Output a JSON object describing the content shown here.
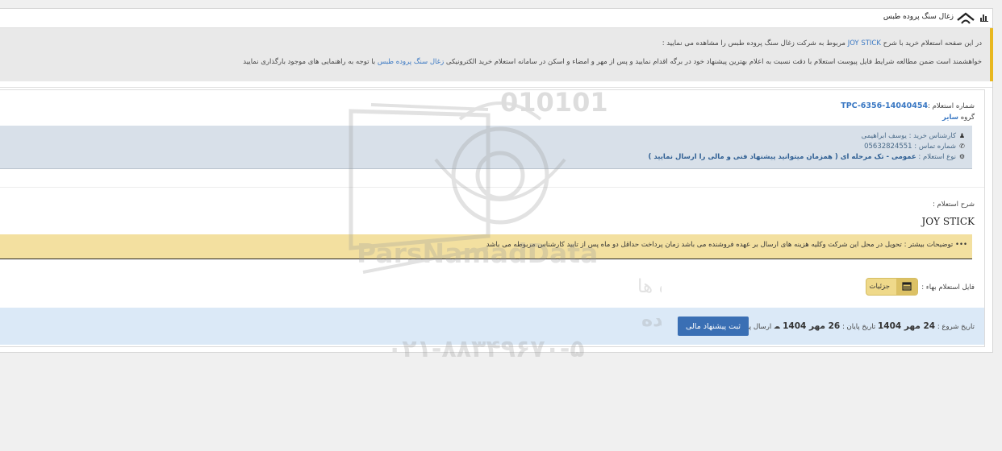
{
  "header": {
    "title": "زغال سنگ پروده طبس"
  },
  "intro": {
    "line1_pre": "در این صفحه استعلام خرید با شرح ",
    "line1_link": "JOY STICK",
    "line1_post": " مربوط به شرکت زغال سنگ پروده طبس را مشاهده می نمایید :",
    "line2_pre": "خواهشمند است ضمن مطالعه شرایط فایل پیوست استعلام با دقت نسبت به اعلام بهترین پیشنهاد خود در برگه اقدام نمایید و پس از مهر و امضاء و اسکن در سامانه استعلام خرید الکترونیکی ",
    "line2_link": "زغال سنگ پروده طبس",
    "line2_post": " با توجه به راهنمایی های موجود بارگذاری نمایید"
  },
  "inquiry": {
    "number_label": "شماره استعلام :",
    "number_value": "TPC-6356-14040454",
    "group_label": "گروه",
    "group_value": "سایر"
  },
  "contact": {
    "expert": "کارشناس خرید : یوسف ابراهیمی",
    "phone_label": "شماره تماس :",
    "phone_value": "05632824551",
    "type_label": "نوع استعلام :",
    "type_value": "عمومی - تک مرحله ای ( همزمان میتوانید پیشنهاد فنی و مالی را ارسال نمایید )"
  },
  "description": {
    "label": "شرح استعلام :",
    "value": "JOY STICK"
  },
  "note": {
    "text": "توضیحات بیشتر : تحویل در محل این شرکت وکلیه هزینه های ارسال بر عهده فروشنده می باشد زمان پرداخت حداقل دو ماه پس از تایید کارشناس مربوطه می باشد"
  },
  "file": {
    "label": "فایل استعلام بهاء :",
    "details_label": "جزئیات"
  },
  "dates": {
    "start_label": "تاریخ شروع :",
    "start_value": "24 مهر 1404",
    "end_label": "تاریخ پایان :",
    "end_value": "26 مهر 1404",
    "send_label": "ارسال پیشنهاد :",
    "submit_label": "ثبت پیشنهاد مالی"
  },
  "watermark": {
    "digits": "010101",
    "brand": "ParsNamadData",
    "line1": "مرکز فرآوری اطلاعات پارس نماد داده ها",
    "line2": "پایگاه اطلاع رسانی مناقصه و مزایده",
    "phone": "۰۲۱-۸۸۳۴۹۶۷۰-۵"
  },
  "colors": {
    "accent": "#e8b820",
    "link": "#3a78c3",
    "submit": "#3a6fb4",
    "note_bg": "#f3e0a0",
    "contact_bg": "#d8e0e9",
    "dates_bg": "#dbe9f7"
  },
  "icons": [
    "chart-icon",
    "logo-icon",
    "user-icon",
    "phone-icon",
    "gear-icon",
    "list-icon",
    "cloud-upload-icon",
    "dots-icon"
  ]
}
